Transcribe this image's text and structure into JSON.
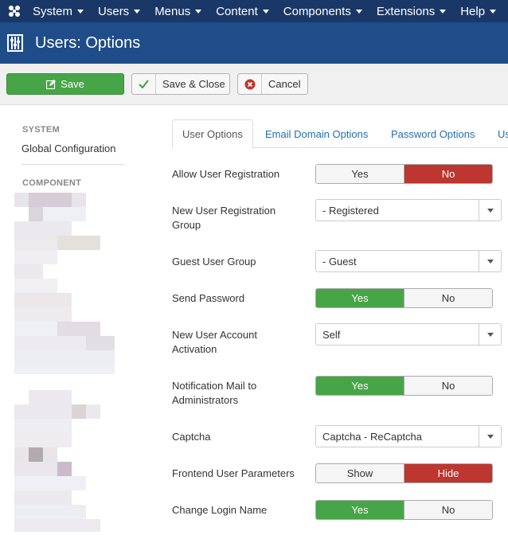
{
  "topnav": {
    "items": [
      {
        "label": "System"
      },
      {
        "label": "Users"
      },
      {
        "label": "Menus"
      },
      {
        "label": "Content"
      },
      {
        "label": "Components"
      },
      {
        "label": "Extensions"
      },
      {
        "label": "Help"
      }
    ]
  },
  "titlebar": {
    "title": "Users: Options",
    "icon": "options-icon"
  },
  "toolbar": {
    "save_label": "Save",
    "save_close_label": "Save & Close",
    "cancel_label": "Cancel"
  },
  "sidebar": {
    "system_heading": "SYSTEM",
    "global_config": "Global Configuration",
    "component_heading": "COMPONENT"
  },
  "tabs": [
    {
      "label": "User Options",
      "active": true
    },
    {
      "label": "Email Domain Options"
    },
    {
      "label": "Password Options"
    },
    {
      "label": "Us"
    }
  ],
  "fields": {
    "allow_registration": {
      "label": "Allow User Registration",
      "on": "Yes",
      "off": "No",
      "value": "No"
    },
    "new_reg_group": {
      "label": "New User Registration Group",
      "value": "- Registered"
    },
    "guest_group": {
      "label": "Guest User Group",
      "value": "- Guest"
    },
    "send_password": {
      "label": "Send Password",
      "on": "Yes",
      "off": "No",
      "value": "Yes"
    },
    "activation": {
      "label": "New User Account Activation",
      "value": "Self"
    },
    "notify_admins": {
      "label": "Notification Mail to Administrators",
      "on": "Yes",
      "off": "No",
      "value": "Yes"
    },
    "captcha": {
      "label": "Captcha",
      "value": "Captcha - ReCaptcha"
    },
    "frontend_params": {
      "label": "Frontend User Parameters",
      "on": "Show",
      "off": "Hide",
      "value": "Hide"
    },
    "change_login": {
      "label": "Change Login Name",
      "on": "Yes",
      "off": "No",
      "value": "Yes"
    }
  },
  "colors": {
    "nav_bg": "#1a3867",
    "title_bg": "#1f4d8a",
    "save_green": "#46a546",
    "toggle_green": "#46a546",
    "toggle_red": "#bd362f",
    "link_blue": "#1f6fb2"
  }
}
